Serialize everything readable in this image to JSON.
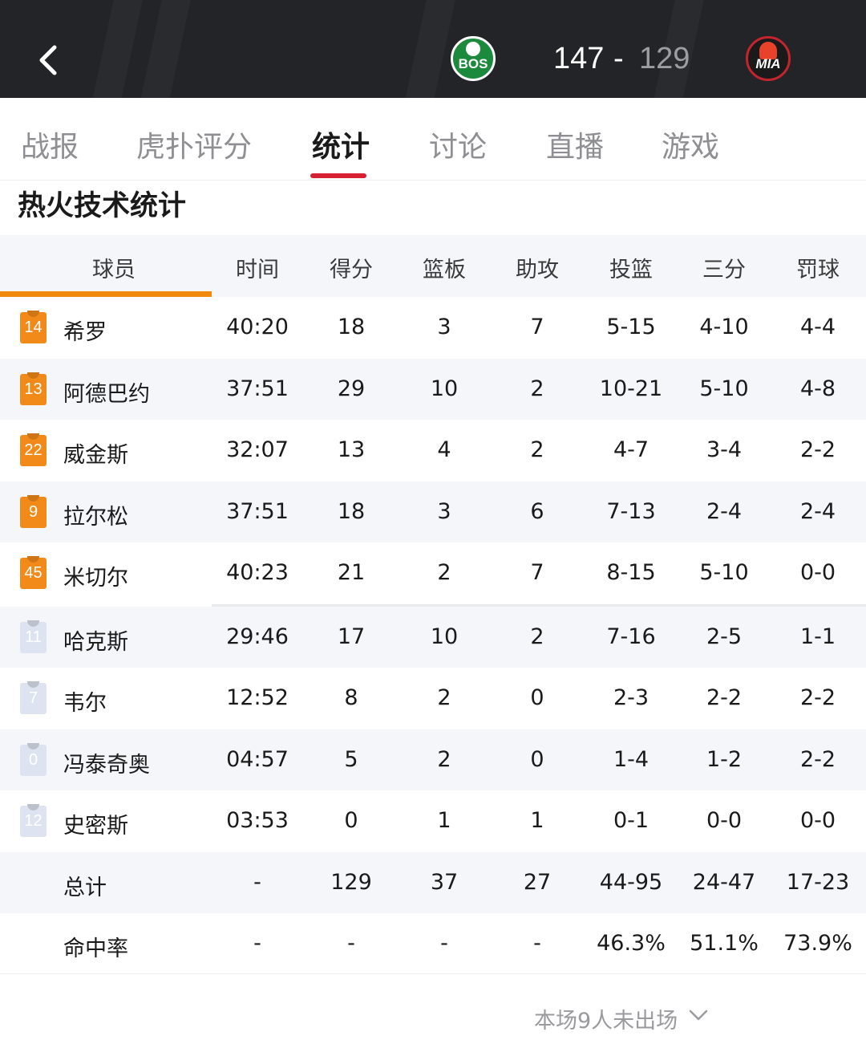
{
  "header": {
    "home_team": "BOS",
    "away_team": "MIA",
    "home_score": "147",
    "separator": "-",
    "away_score": "129",
    "home_color": "#1b8a3c",
    "away_color": "#c4252c",
    "back_icon": "chevron-left-icon"
  },
  "tabs": [
    {
      "label": "战报"
    },
    {
      "label": "虎扑评分"
    },
    {
      "label": "统计",
      "active": true
    },
    {
      "label": "讨论"
    },
    {
      "label": "直播"
    },
    {
      "label": "游戏"
    }
  ],
  "section_title": "热火技术统计",
  "table": {
    "headers": [
      "球员",
      "时间",
      "得分",
      "篮板",
      "助攻",
      "投篮",
      "三分",
      "罚球"
    ],
    "starters": [
      {
        "number": "14",
        "name": "希罗",
        "time": "40:20",
        "pts": "18",
        "reb": "3",
        "ast": "7",
        "fg": "5-15",
        "tp": "4-10",
        "ft": "4-4"
      },
      {
        "number": "13",
        "name": "阿德巴约",
        "time": "37:51",
        "pts": "29",
        "reb": "10",
        "ast": "2",
        "fg": "10-21",
        "tp": "5-10",
        "ft": "4-8"
      },
      {
        "number": "22",
        "name": "威金斯",
        "time": "32:07",
        "pts": "13",
        "reb": "4",
        "ast": "2",
        "fg": "4-7",
        "tp": "3-4",
        "ft": "2-2"
      },
      {
        "number": "9",
        "name": "拉尔松",
        "time": "37:51",
        "pts": "18",
        "reb": "3",
        "ast": "6",
        "fg": "7-13",
        "tp": "2-4",
        "ft": "2-4"
      },
      {
        "number": "45",
        "name": "米切尔",
        "time": "40:23",
        "pts": "21",
        "reb": "2",
        "ast": "7",
        "fg": "8-15",
        "tp": "5-10",
        "ft": "0-0"
      }
    ],
    "bench": [
      {
        "number": "11",
        "name": "哈克斯",
        "time": "29:46",
        "pts": "17",
        "reb": "10",
        "ast": "2",
        "fg": "7-16",
        "tp": "2-5",
        "ft": "1-1"
      },
      {
        "number": "7",
        "name": "韦尔",
        "time": "12:52",
        "pts": "8",
        "reb": "2",
        "ast": "0",
        "fg": "2-3",
        "tp": "2-2",
        "ft": "2-2"
      },
      {
        "number": "0",
        "name": "冯泰奇奥",
        "time": "04:57",
        "pts": "5",
        "reb": "2",
        "ast": "0",
        "fg": "1-4",
        "tp": "1-2",
        "ft": "2-2"
      },
      {
        "number": "12",
        "name": "史密斯",
        "time": "03:53",
        "pts": "0",
        "reb": "1",
        "ast": "1",
        "fg": "0-1",
        "tp": "0-0",
        "ft": "0-0"
      }
    ],
    "totals": {
      "name": "总计",
      "time": "-",
      "pts": "129",
      "reb": "37",
      "ast": "27",
      "fg": "44-95",
      "tp": "24-47",
      "ft": "17-23"
    },
    "percent": {
      "name": "命中率",
      "time": "-",
      "pts": "-",
      "reb": "-",
      "ast": "-",
      "fg": "46.3%",
      "tp": "51.1%",
      "ft": "73.9%"
    }
  },
  "footer": {
    "dnp_label": "本场9人未出场"
  },
  "colors": {
    "accent": "#d72031",
    "starter_jersey": "#f28a1a",
    "bench_jersey": "#dde3f0",
    "header_bg": "#232427"
  }
}
